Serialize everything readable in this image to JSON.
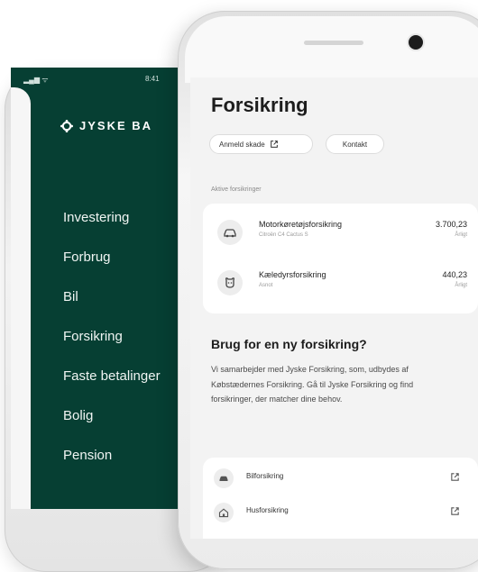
{
  "back_phone": {
    "status_time": "8:41",
    "brand": "JYSKE BA",
    "menu": [
      "Investering",
      "Forbrug",
      "Bil",
      "Forsikring",
      "Faste betalinger",
      "Bolig",
      "Pension"
    ]
  },
  "front_phone": {
    "title": "Forsikring",
    "actions": {
      "report_claim": "Anmeld skade",
      "contact": "Kontakt"
    },
    "active_label": "Aktive forsikringer",
    "policies": [
      {
        "name": "Motorkøretøjsforsikring",
        "sub": "Citroën C4 Cactus S",
        "amount": "3.700,23",
        "period": "Årligt",
        "icon": "car-icon"
      },
      {
        "name": "Kæledyrsforsikring",
        "sub": "Asnot",
        "amount": "440,23",
        "period": "Årligt",
        "icon": "pet-icon"
      }
    ],
    "need_title": "Brug for en ny forsikring?",
    "need_text": "Vi samarbejder med Jyske Forsikring, som, udbydes af Købstædernes Forsikring. Gå til Jyske Forsikring og find forsikringer, der matcher dine behov.",
    "products": [
      {
        "name": "Bilforsikring",
        "icon": "car-icon"
      },
      {
        "name": "Husforsikring",
        "icon": "house-icon"
      }
    ]
  }
}
